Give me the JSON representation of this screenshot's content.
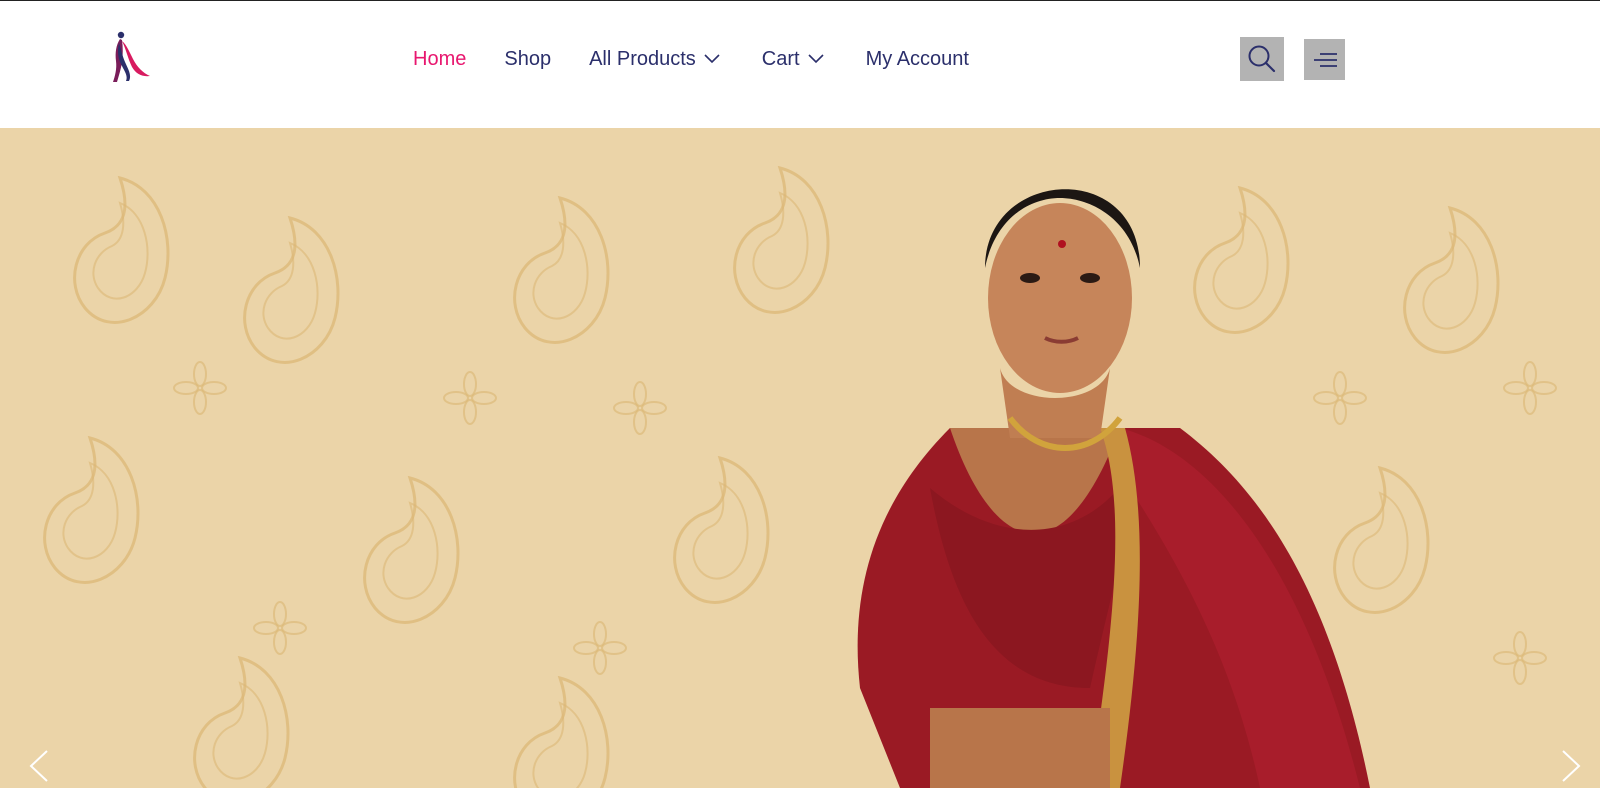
{
  "brand": {
    "logo_icon": "saree-figure-logo"
  },
  "nav": {
    "items": [
      {
        "label": "Home",
        "active": true
      },
      {
        "label": "Shop",
        "active": false
      },
      {
        "label": "All Products",
        "active": false,
        "has_dropdown": true
      },
      {
        "label": "Cart",
        "active": false,
        "has_dropdown": true
      },
      {
        "label": "My Account",
        "active": false
      }
    ]
  },
  "header_actions": {
    "search_icon": "search-icon",
    "menu_icon": "hamburger-menu-icon"
  },
  "hero": {
    "image_subject": "woman in red embroidered lehenga on paisley background",
    "prev_icon": "chevron-left-icon",
    "next_icon": "chevron-right-icon"
  },
  "colors": {
    "nav_text": "#2b2f6b",
    "nav_active": "#e8176f",
    "icon_button_bg": "#b3b3b3",
    "hero_bg": "#ebd4a8"
  }
}
